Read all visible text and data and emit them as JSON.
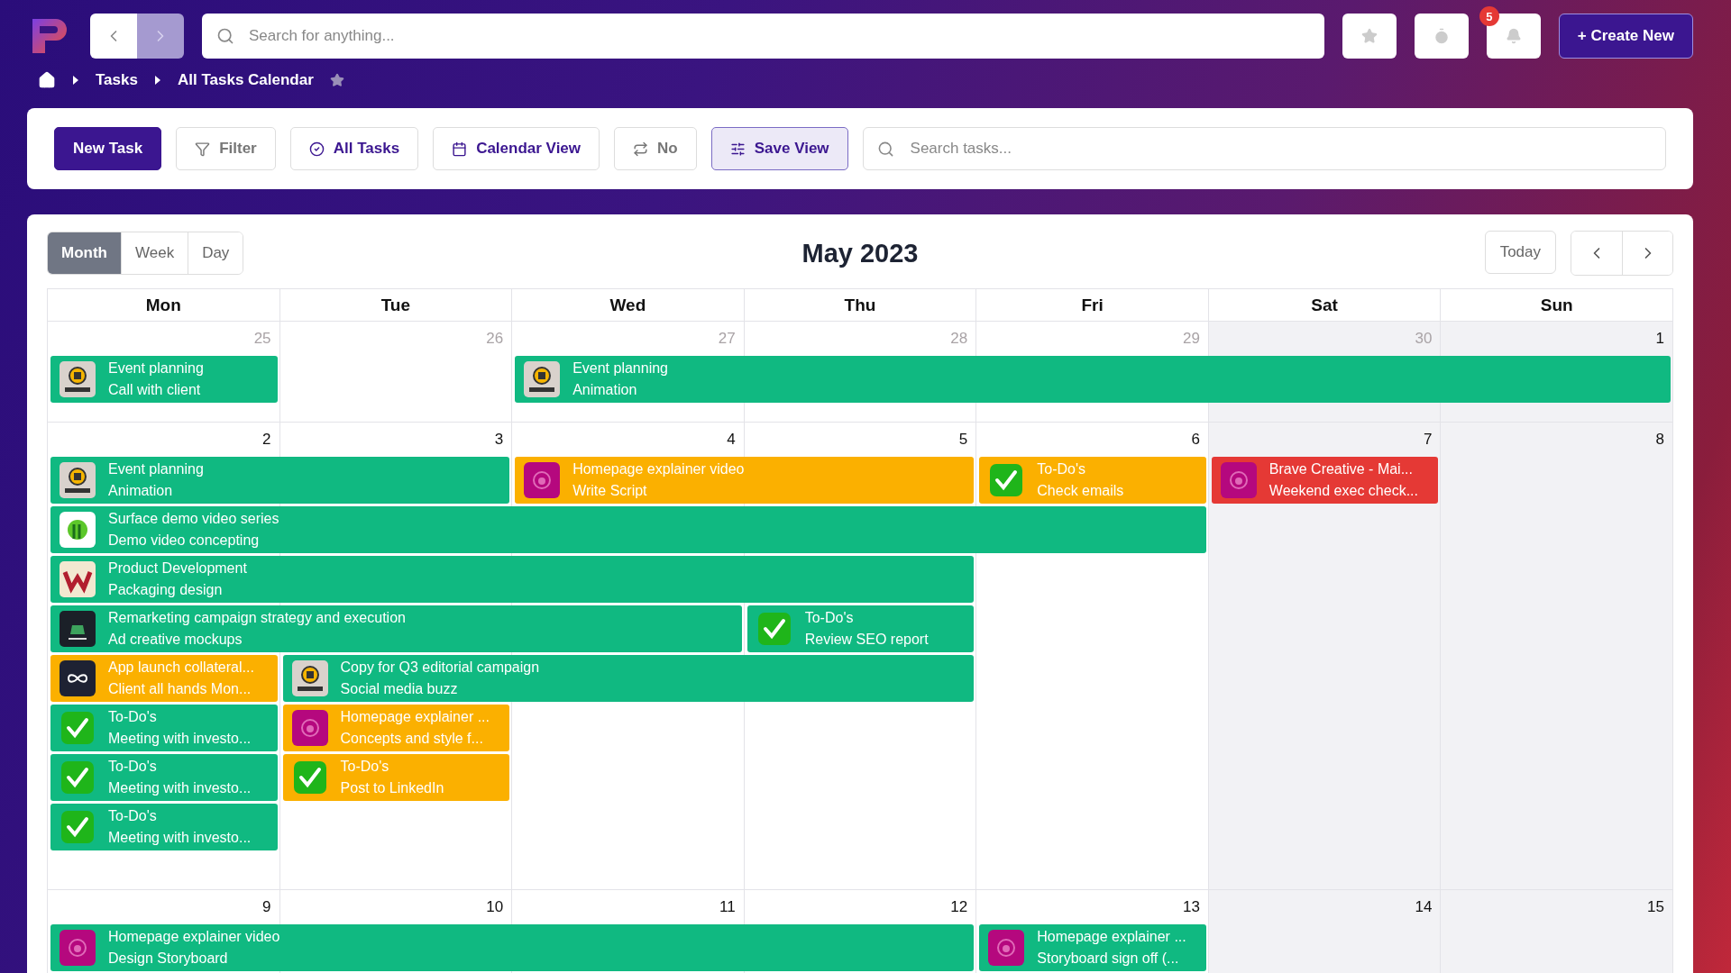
{
  "topbar": {
    "search": {
      "placeholder": "Search for anything..."
    },
    "notifications": "5",
    "create_button": "+ Create New"
  },
  "breadcrumb": [
    "Tasks",
    "All Tasks Calendar"
  ],
  "toolbar": {
    "buttons": [
      {
        "kind": "primary",
        "label": "New Task"
      },
      {
        "kind": "muted",
        "label": "Filter"
      },
      {
        "kind": "plain",
        "label": "All Tasks"
      },
      {
        "kind": "plain",
        "label": "Calendar View"
      },
      {
        "kind": "muted",
        "label": "No"
      },
      {
        "kind": "active",
        "label": "Save View"
      }
    ],
    "search": {
      "placeholder": "Search tasks..."
    }
  },
  "calendar": {
    "views": [
      {
        "label": "Month",
        "selected": true
      },
      {
        "label": "Week",
        "selected": false
      },
      {
        "label": "Day",
        "selected": false
      }
    ],
    "title": "May 2023",
    "today_button": "Today",
    "columns": [
      {
        "label": "Mon",
        "weekend": false
      },
      {
        "label": "Tue",
        "weekend": false
      },
      {
        "label": "Wed",
        "weekend": false
      },
      {
        "label": "Thu",
        "weekend": false
      },
      {
        "label": "Fri",
        "weekend": false
      },
      {
        "label": "Sat",
        "weekend": true
      },
      {
        "label": "Sun",
        "weekend": true
      }
    ],
    "weeks": [
      {
        "dates": [
          {
            "date": "25",
            "outside": true
          },
          {
            "date": "26",
            "outside": true
          },
          {
            "date": "27",
            "outside": true
          },
          {
            "date": "28",
            "outside": true
          },
          {
            "date": "29",
            "outside": true
          },
          {
            "date": "30",
            "outside": true
          },
          {
            "date": "1",
            "outside": false
          }
        ],
        "lanes": [
          {
            "events": [
              {
                "color": "#10b981",
                "kind": "brewery",
                "title": "Event planning",
                "subtitle": "Call with client"
              },
              {
                "color": "#10b981",
                "kind": "brewery",
                "title": "Event planning",
                "subtitle": "Animation"
              }
            ]
          }
        ]
      },
      {
        "dates": [
          {
            "date": "2",
            "outside": false
          },
          {
            "date": "3",
            "outside": false
          },
          {
            "date": "4",
            "outside": false
          },
          {
            "date": "5",
            "outside": false
          },
          {
            "date": "6",
            "outside": false
          },
          {
            "date": "7",
            "outside": false
          },
          {
            "date": "8",
            "outside": false
          }
        ],
        "lanes": [
          {
            "events": [
              {
                "color": "#10b981",
                "kind": "brewery",
                "title": "Event planning",
                "subtitle": "Animation"
              },
              {
                "color": "#fbb000",
                "kind": "lion",
                "title": "Homepage explainer video",
                "subtitle": "Write Script"
              },
              {
                "color": "#fbb000",
                "kind": "check",
                "title": "To-Do's",
                "subtitle": "Check emails"
              },
              {
                "color": "#e53935",
                "kind": "lion",
                "title": "Brave Creative - Mai...",
                "subtitle": "Weekend exec check..."
              }
            ]
          },
          {
            "events": [
              {
                "color": "#10b981",
                "kind": "surface",
                "title": "Surface demo video series",
                "subtitle": "Demo video concepting"
              }
            ]
          },
          {
            "events": [
              {
                "color": "#10b981",
                "kind": "w",
                "title": "Product Development",
                "subtitle": "Packaging design"
              }
            ]
          },
          {
            "events": [
              {
                "color": "#10b981",
                "kind": "dark",
                "title": "Remarketing campaign strategy and execution",
                "subtitle": "Ad creative mockups"
              },
              {
                "color": "#10b981",
                "kind": "check",
                "title": "To-Do's",
                "subtitle": "Review SEO report"
              }
            ]
          },
          {
            "events": [
              {
                "color": "#fbb000",
                "kind": "infinity",
                "title": "App launch collateral...",
                "subtitle": "Client all hands Mon..."
              },
              {
                "color": "#10b981",
                "kind": "brewery",
                "title": "Copy for Q3 editorial campaign",
                "subtitle": "Social media buzz"
              }
            ]
          },
          {
            "events": [
              {
                "color": "#10b981",
                "kind": "check",
                "title": "To-Do's",
                "subtitle": "Meeting with investo..."
              },
              {
                "color": "#fbb000",
                "kind": "lion",
                "title": "Homepage explainer ...",
                "subtitle": "Concepts and style f..."
              }
            ]
          },
          {
            "events": [
              {
                "color": "#10b981",
                "kind": "check",
                "title": "To-Do's",
                "subtitle": "Meeting with investo..."
              },
              {
                "color": "#fbb000",
                "kind": "check",
                "title": "To-Do's",
                "subtitle": "Post to LinkedIn"
              }
            ]
          },
          {
            "events": [
              {
                "color": "#10b981",
                "kind": "check",
                "title": "To-Do's",
                "subtitle": "Meeting with investo..."
              }
            ]
          }
        ]
      },
      {
        "dates": [
          {
            "date": "9",
            "outside": false
          },
          {
            "date": "10",
            "outside": false
          },
          {
            "date": "11",
            "outside": false
          },
          {
            "date": "12",
            "outside": false
          },
          {
            "date": "13",
            "outside": false
          },
          {
            "date": "14",
            "outside": false
          },
          {
            "date": "15",
            "outside": false
          }
        ],
        "lanes": [
          {
            "events": [
              {
                "color": "#10b981",
                "kind": "lion",
                "title": "Homepage explainer video",
                "subtitle": "Design Storyboard"
              },
              {
                "color": "#10b981",
                "kind": "lion",
                "title": "Homepage explainer ...",
                "subtitle": "Storyboard sign off (..."
              }
            ]
          }
        ]
      }
    ]
  }
}
